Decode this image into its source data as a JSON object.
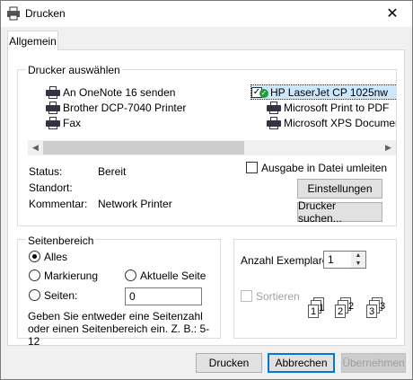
{
  "window": {
    "title": "Drucken"
  },
  "tabs": [
    {
      "label": "Allgemein"
    }
  ],
  "printer_group": {
    "label": "Drucker auswählen",
    "printers": [
      {
        "name": "An OneNote 16 senden"
      },
      {
        "name": "Brother DCP-7040 Printer"
      },
      {
        "name": "Fax"
      },
      {
        "name": "HP LaserJet CP 1025nw",
        "selected": true,
        "default": true
      },
      {
        "name": "Microsoft Print to PDF"
      },
      {
        "name": "Microsoft XPS Document Writer"
      }
    ]
  },
  "status": {
    "status_label": "Status:",
    "status_value": "Bereit",
    "location_label": "Standort:",
    "location_value": "",
    "comment_label": "Kommentar:",
    "comment_value": "Network Printer"
  },
  "print_to_file": {
    "label": "Ausgabe in Datei umleiten",
    "checked": false
  },
  "buttons": {
    "preferences": "Einstellungen",
    "find_printer": "Drucker suchen...",
    "print": "Drucken",
    "cancel": "Abbrechen",
    "apply": "Übernehmen"
  },
  "page_range": {
    "label": "Seitenbereich",
    "all": "Alles",
    "selection": "Markierung",
    "current_page": "Aktuelle Seite",
    "pages": "Seiten:",
    "pages_value": "0",
    "selected": "all",
    "hint": "Geben Sie entweder eine Seitenzahl oder einen Seitenbereich ein. Z. B.: 5-12"
  },
  "copies": {
    "label": "Anzahl Exemplare:",
    "value": "1",
    "collate_label": "Sortieren",
    "collate_checked": false,
    "collate_enabled": false
  },
  "colors": {
    "accent": "#0078d7",
    "selection": "#cce8ff"
  },
  "icons": {
    "app": "printer-icon",
    "close": "close-icon",
    "default_printer": "checkmark-badge-icon"
  }
}
